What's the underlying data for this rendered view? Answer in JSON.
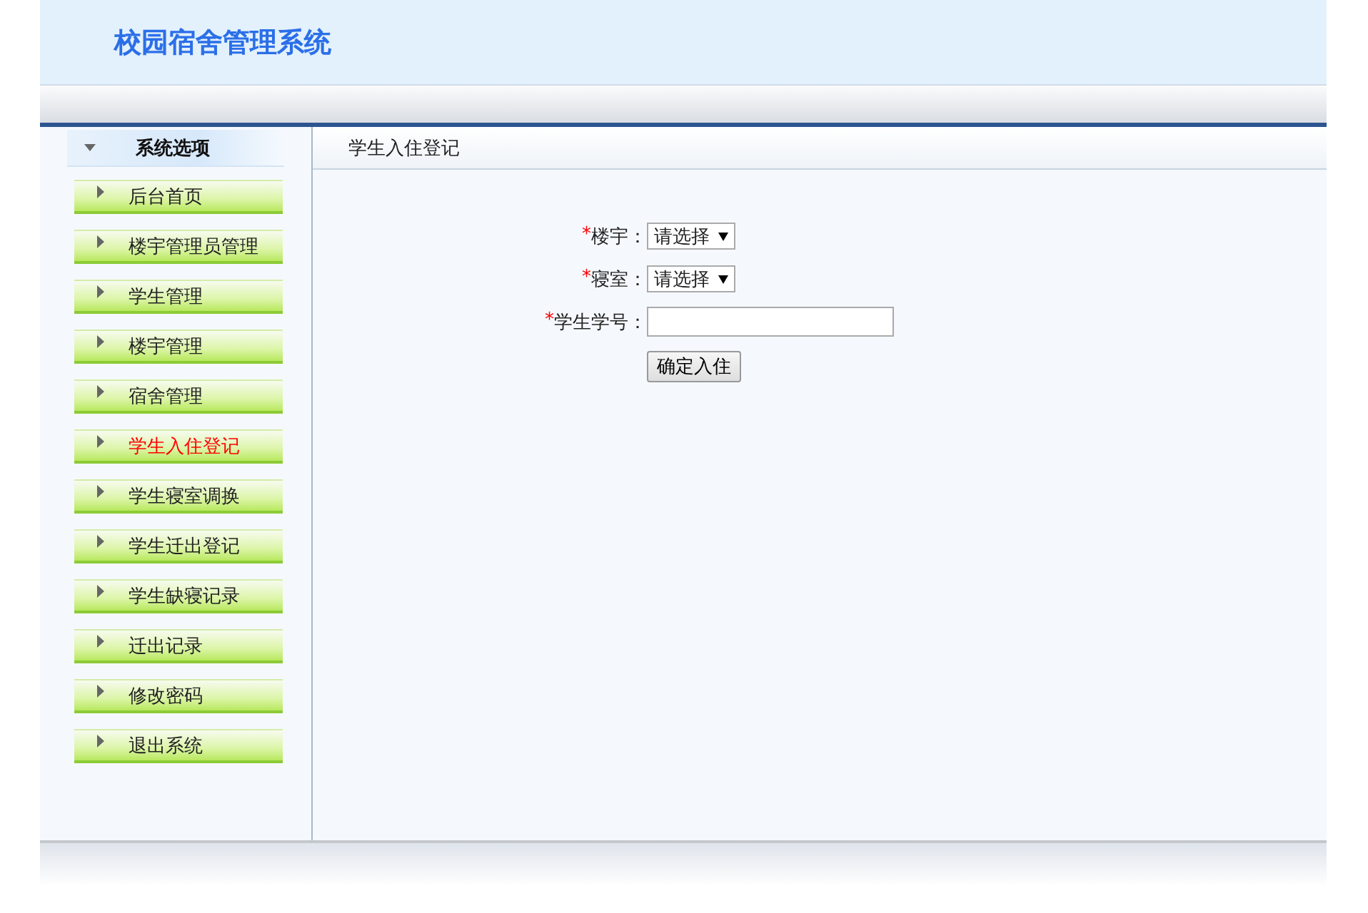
{
  "header": {
    "title": "校园宿舍管理系统"
  },
  "sidebar": {
    "title": "系统选项",
    "items": [
      {
        "label": "后台首页",
        "selected": false
      },
      {
        "label": "楼宇管理员管理",
        "selected": false
      },
      {
        "label": "学生管理",
        "selected": false
      },
      {
        "label": "楼宇管理",
        "selected": false
      },
      {
        "label": "宿舍管理",
        "selected": false
      },
      {
        "label": "学生入住登记",
        "selected": true
      },
      {
        "label": "学生寝室调换",
        "selected": false
      },
      {
        "label": "学生迁出登记",
        "selected": false
      },
      {
        "label": "学生缺寝记录",
        "selected": false
      },
      {
        "label": "迁出记录",
        "selected": false
      },
      {
        "label": "修改密码",
        "selected": false
      },
      {
        "label": "退出系统",
        "selected": false
      }
    ]
  },
  "main": {
    "title": "学生入住登记",
    "fields": [
      {
        "kind": "select",
        "required_mark": "*",
        "label": "楼宇：",
        "value": "请选择"
      },
      {
        "kind": "select",
        "required_mark": "*",
        "label": "寝室：",
        "value": "请选择"
      },
      {
        "kind": "text",
        "required_mark": "*",
        "label": "学生学号："
      }
    ],
    "submit": "确定入住"
  }
}
